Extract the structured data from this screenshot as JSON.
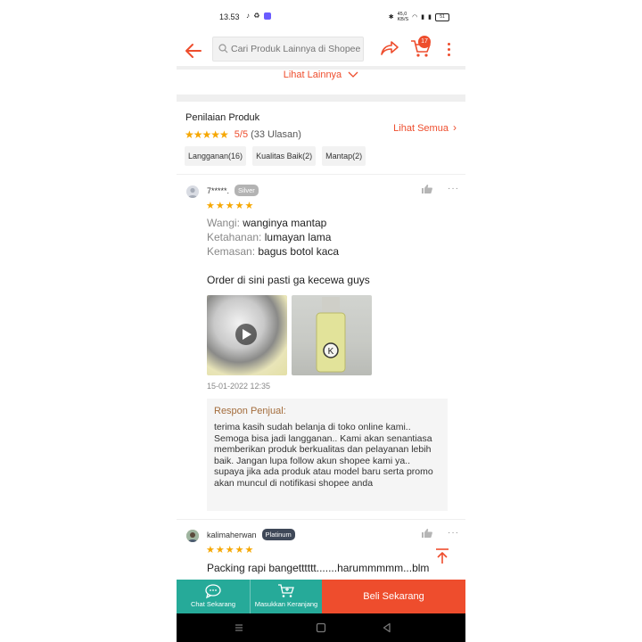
{
  "status_bar": {
    "time": "13.53",
    "left_icons": "♪ ♻",
    "net_speed_top": "45,0",
    "net_speed_bottom": "KB/S",
    "battery": "51"
  },
  "header": {
    "search_placeholder": "Cari Produk Lainnya di Shopee",
    "cart_count": "17"
  },
  "see_more": {
    "label": "Lihat Lainnya"
  },
  "ratings": {
    "title": "Penilaian Produk",
    "score": "5/5",
    "count": "(33 Ulasan)",
    "see_all": "Lihat Semua",
    "chips": [
      "Langganan(16)",
      "Kualitas Baik(2)",
      "Mantap(2)"
    ]
  },
  "reviews": [
    {
      "username": "7*****.",
      "badge": "Silver",
      "stars": "★★★★★",
      "lines": [
        {
          "key": "Wangi:",
          "value": " wanginya mantap"
        },
        {
          "key": "Ketahanan:",
          "value": " lumayan lama"
        },
        {
          "key": "Kemasan:",
          "value": " bagus botol kaca"
        }
      ],
      "comment": "Order di sini pasti ga kecewa guys",
      "date": "15-01-2022 12:35",
      "seller_response": {
        "title": "Respon Penjual:",
        "body": "terima kasih sudah belanja di toko online kami.. Semoga bisa jadi langganan.. Kami akan senantiasa memberikan produk berkualitas dan pelayanan lebih baik. Jangan lupa follow akun shopee kami ya.. supaya jika ada produk atau model baru serta promo akan muncul di notifikasi shopee anda"
      }
    },
    {
      "username": "kalimaherwan",
      "badge": "Platinum",
      "stars": "★★★★★",
      "comment": "Packing rapi bangetttttt.......harummmmm...blm"
    }
  ],
  "bottom_bar": {
    "chat": "Chat Sekarang",
    "add_cart": "Masukkan Keranjang",
    "buy": "Beli Sekarang"
  },
  "colors": {
    "accent": "#ee4d2d",
    "teal": "#26aa99",
    "star": "#f6a700"
  }
}
